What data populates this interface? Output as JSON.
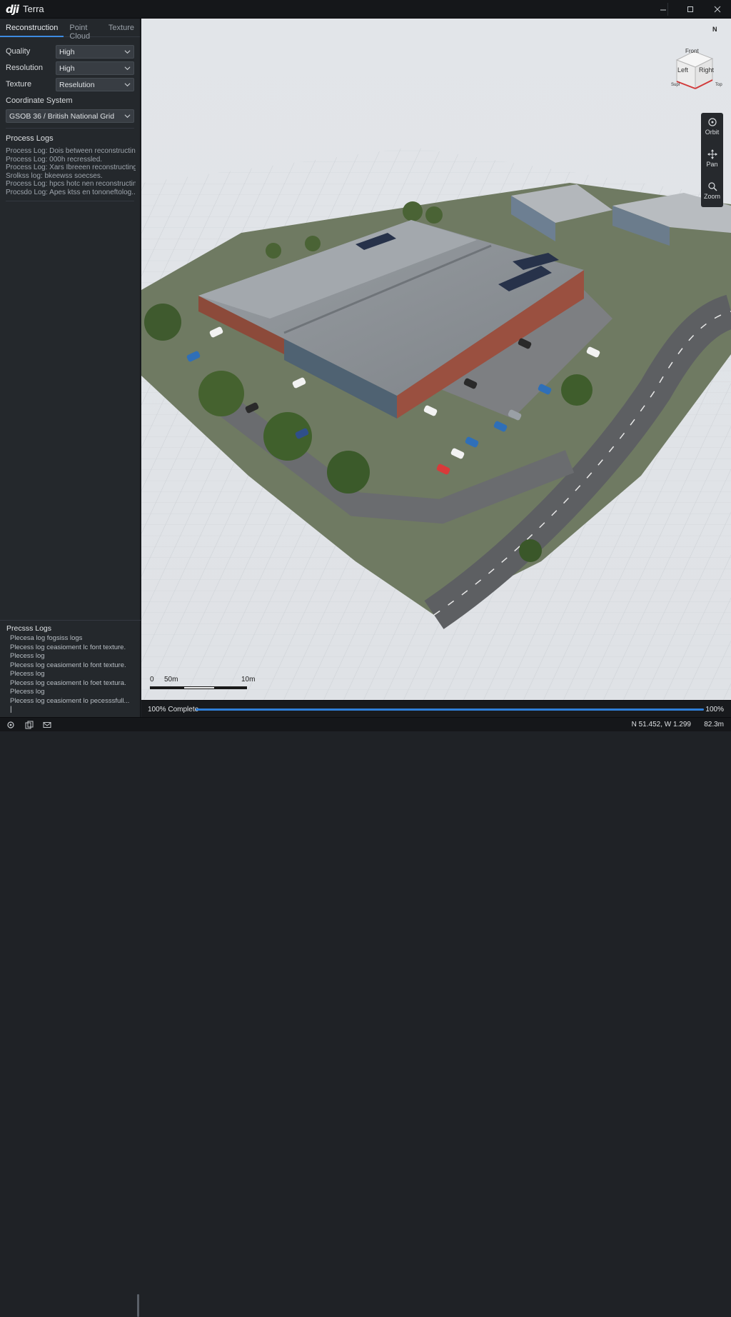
{
  "app": {
    "logo": "dji",
    "title": "Terra"
  },
  "window_controls": [
    "minimize",
    "maximize",
    "close"
  ],
  "tabs": [
    {
      "label": "Reconstruction",
      "active": true
    },
    {
      "label": "Point Cloud",
      "active": false
    },
    {
      "label": "Texture",
      "active": false
    }
  ],
  "settings": {
    "quality": {
      "label": "Quality",
      "value": "High"
    },
    "resolution": {
      "label": "Resolution",
      "value": "High"
    },
    "texture": {
      "label": "Texture",
      "value": "Reselution"
    },
    "coordinate_system": {
      "label": "Coordinate System",
      "value": "GSOB 36 / British National Grid"
    }
  },
  "process_logs": {
    "title": "Process Logs",
    "lines": [
      "Process Log: Dois between reconstructing",
      "Process Log: 000h recressled.",
      "Process Log: Xars Ibreeen reconstructing",
      "Srolkss log: bkeewss soecses.",
      "Process Log: hpcs hotc nen reconstructing",
      "Procsdo Log: Apes ktss en tononeftolog..."
    ]
  },
  "bottom_logs": {
    "title": "Precsss Logs",
    "lines": [
      "Plecesa log fogsiss logs",
      "Plecess log ceasioment lc font texture.",
      "Plecess log",
      "Plecess log ceasioment lo font texture.",
      "Plecess log",
      "Plecess log ceasioment lo foet textura.",
      "Plecess log",
      "Plecess log ceasioment lo pecesssfull..."
    ],
    "cursor": "|"
  },
  "view_cube": {
    "north": "N",
    "front": "Front",
    "left": "Left",
    "right": "Right",
    "bottom_left": "Supl",
    "bottom_right": "Top"
  },
  "nav_tools": [
    {
      "label": "Orbit",
      "icon": "orbit-icon"
    },
    {
      "label": "Pan",
      "icon": "pan-icon"
    },
    {
      "label": "Zoom",
      "icon": "zoom-icon"
    }
  ],
  "scale": {
    "start": "0",
    "mid": "50m",
    "end": "10m"
  },
  "progress": {
    "label": "100% Complete",
    "percent_text": "100%",
    "value": 1.0
  },
  "status": {
    "coordinates": "N 51.452, W 1.299",
    "distance": "82.3m",
    "icons": [
      "settings-icon",
      "copy-icon",
      "mail-icon"
    ]
  },
  "colors": {
    "accent": "#2f7fd9",
    "panel": "#24282c",
    "viewport": "#e2e5e9"
  }
}
